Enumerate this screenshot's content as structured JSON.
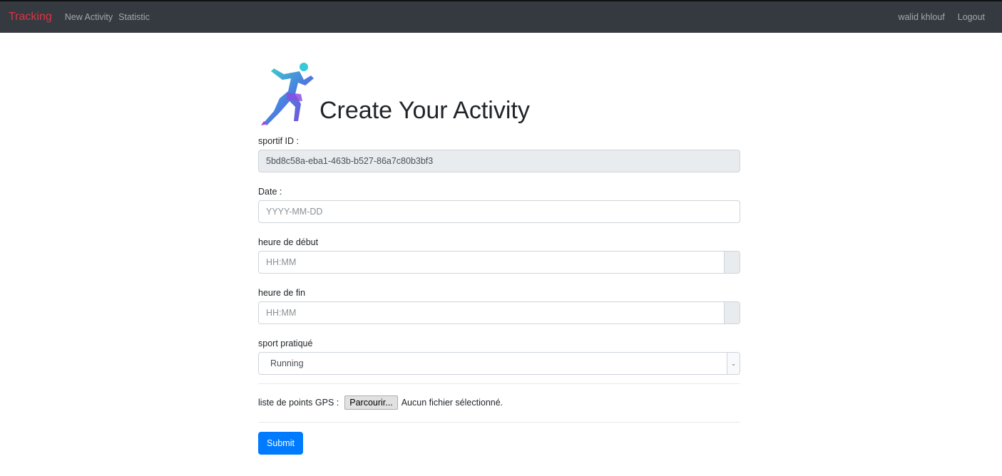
{
  "navbar": {
    "brand": "Tracking",
    "links": [
      "New Activity",
      "Statistic"
    ],
    "user": "walid khlouf",
    "logout": "Logout"
  },
  "page": {
    "title": "Create Your Activity",
    "logo": "runner-icon"
  },
  "form": {
    "sportif_id": {
      "label": "sportif ID :",
      "value": "5bd8c58a-eba1-463b-b527-86a7c80b3bf3"
    },
    "date": {
      "label": "Date :",
      "placeholder": "YYYY-MM-DD"
    },
    "start": {
      "label": "heure de début",
      "placeholder": "HH:MM"
    },
    "end": {
      "label": "heure de fin",
      "placeholder": "HH:MM"
    },
    "sport": {
      "label": "sport pratiqué",
      "selected": "Running"
    },
    "gps": {
      "label": "liste de points GPS :",
      "button": "Parcourir...",
      "status": "Aucun fichier sélectionné."
    },
    "submit": "Submit"
  },
  "colors": {
    "navbar_bg": "#343a40",
    "brand": "#dc3545",
    "primary": "#007bff"
  }
}
